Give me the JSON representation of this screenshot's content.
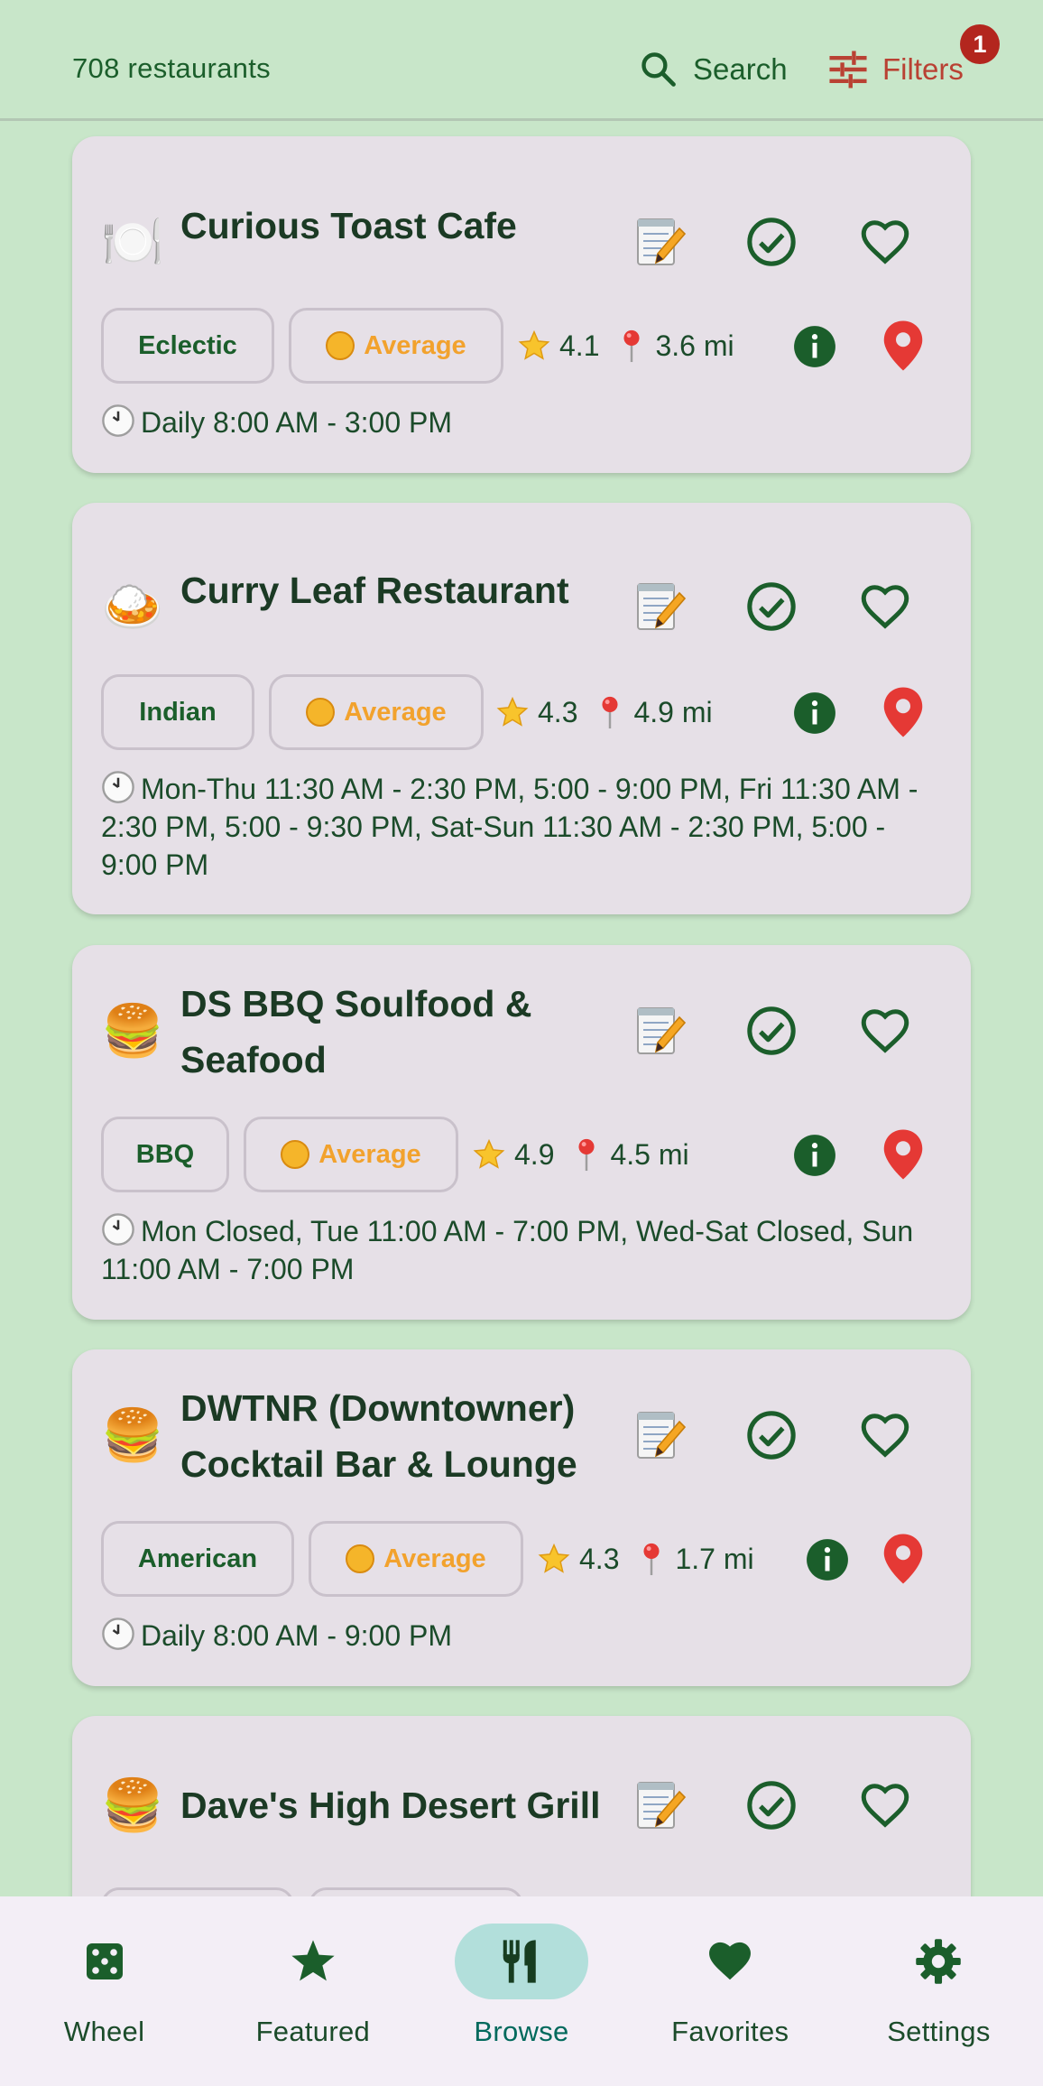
{
  "header": {
    "count_text": "708 restaurants",
    "search_label": "Search",
    "filters_label": "Filters",
    "filters_badge": "1"
  },
  "restaurants": [
    {
      "emoji": "🍽️",
      "name": "Curious Toast Cafe",
      "cuisine": "Eclectic",
      "price": "Average",
      "rating": "4.1",
      "distance": "3.6 mi",
      "hours": "Daily 8:00 AM - 3:00 PM"
    },
    {
      "emoji": "🍛",
      "name": "Curry Leaf Restaurant",
      "cuisine": "Indian",
      "price": "Average",
      "rating": "4.3",
      "distance": "4.9 mi",
      "hours": "Mon-Thu 11:30 AM - 2:30 PM, 5:00 - 9:00 PM, Fri 11:30 AM - 2:30 PM, 5:00 - 9:30 PM, Sat-Sun 11:30 AM - 2:30 PM, 5:00 - 9:00 PM"
    },
    {
      "emoji": "🍔",
      "name": "DS BBQ Soulfood & Seafood",
      "cuisine": "BBQ",
      "price": "Average",
      "rating": "4.9",
      "distance": "4.5 mi",
      "hours": "Mon Closed, Tue 11:00 AM - 7:00 PM, Wed-Sat Closed, Sun 11:00 AM - 7:00 PM"
    },
    {
      "emoji": "🍔",
      "name": "DWTNR (Downtowner) Cocktail Bar & Lounge",
      "cuisine": "American",
      "price": "Average",
      "rating": "4.3",
      "distance": "1.7 mi",
      "hours": "Daily 8:00 AM - 9:00 PM"
    },
    {
      "emoji": "🍔",
      "name": "Dave's High Desert Grill"
    }
  ],
  "nav": [
    {
      "label": "Wheel",
      "icon": "dice-icon"
    },
    {
      "label": "Featured",
      "icon": "star-icon"
    },
    {
      "label": "Browse",
      "icon": "utensils-icon",
      "active": true
    },
    {
      "label": "Favorites",
      "icon": "heart-icon"
    },
    {
      "label": "Settings",
      "icon": "gear-icon"
    }
  ],
  "colors": {
    "background": "#c8e6c9",
    "card": "#e6e0e7",
    "primary_green": "#1b5e2b",
    "filters_red": "#b94133",
    "price_orange": "#f2a22d",
    "map_pin_red": "#e53935",
    "active_pill": "#b2dfdb"
  }
}
